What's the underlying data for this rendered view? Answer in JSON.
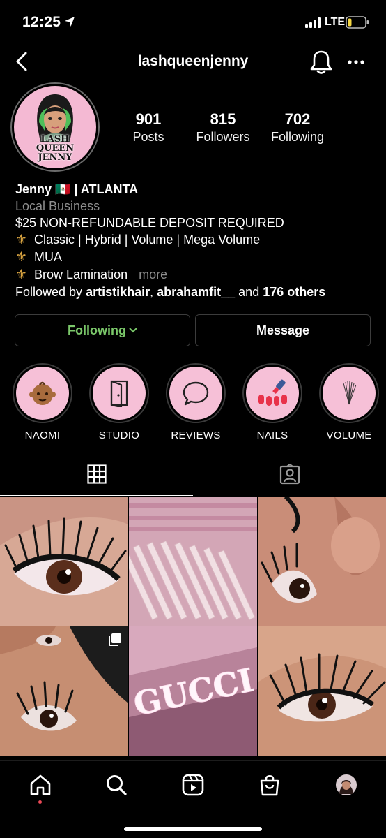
{
  "status_bar": {
    "time": "12:25",
    "network": "LTE"
  },
  "header": {
    "username": "lashqueenjenny"
  },
  "profile": {
    "avatar_text": [
      "LASH",
      "QUEEN",
      "JENNY"
    ],
    "stats": [
      {
        "value": "901",
        "label": "Posts"
      },
      {
        "value": "815",
        "label": "Followers"
      },
      {
        "value": "702",
        "label": "Following"
      }
    ],
    "name": "Jenny 🇲🇽 | ATLANTA",
    "category": "Local Business",
    "bio_lines": [
      "$25 NON-REFUNDABLE DEPOSIT REQUIRED",
      "Classic | Hybrid | Volume | Mega Volume",
      "MUA",
      "Brow Lamination"
    ],
    "more_label": "more",
    "followed_by": {
      "prefix": "Followed by ",
      "user1": "artistikhair",
      "sep": ", ",
      "user2": "abrahamfit__",
      "and": " and ",
      "others": "176 others"
    }
  },
  "buttons": {
    "following": "Following",
    "message": "Message"
  },
  "highlights": [
    {
      "label": "NAOMI",
      "icon": "baby-emoji-icon"
    },
    {
      "label": "STUDIO",
      "icon": "door-icon"
    },
    {
      "label": "REVIEWS",
      "icon": "speech-bubble-icon"
    },
    {
      "label": "NAILS",
      "icon": "nail-polish-icon"
    },
    {
      "label": "VOLUME",
      "icon": "lash-fan-icon"
    }
  ],
  "tabs": [
    {
      "name": "grid",
      "icon": "grid-icon",
      "active": true
    },
    {
      "name": "tagged",
      "icon": "tagged-person-icon",
      "active": false
    }
  ],
  "posts": [
    {
      "subject": "eyelash-extension-closeup"
    },
    {
      "subject": "pink-mascara-wands"
    },
    {
      "subject": "eyelash-extension-closeup"
    },
    {
      "subject": "eyelash-extension-closeup",
      "multi": true
    },
    {
      "subject": "gucci-neon-sign"
    },
    {
      "subject": "eyelash-extension-closeup"
    }
  ],
  "post_text": {
    "gucci": "GUCCI"
  },
  "bottom_nav": [
    {
      "name": "home",
      "icon": "home-icon"
    },
    {
      "name": "search",
      "icon": "search-icon"
    },
    {
      "name": "reels",
      "icon": "reels-icon"
    },
    {
      "name": "shop",
      "icon": "shopping-bag-icon"
    },
    {
      "name": "profile",
      "icon": "profile-avatar-icon"
    }
  ],
  "colors": {
    "background": "#000000",
    "following_green": "#7bc86a",
    "avatar_pink": "#f4b9d3",
    "muted_text": "#8e8e8e",
    "notification_dot": "#ed4956"
  }
}
